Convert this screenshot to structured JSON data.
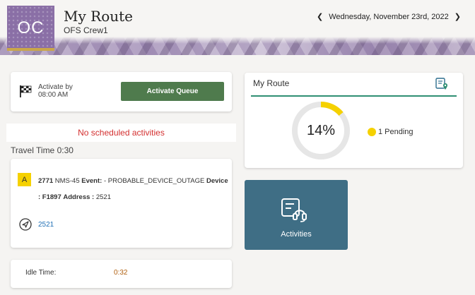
{
  "header": {
    "avatar_initials": "OC",
    "title": "My Route",
    "subtitle": "OFS Crew1",
    "date": "Wednesday, November 23rd, 2022",
    "prev_icon": "chevron-left-icon",
    "next_icon": "chevron-right-icon"
  },
  "activate": {
    "label_line1": "Activate by",
    "label_line2": "08:00 AM",
    "button_label": "Activate Queue",
    "icon": "checkered-flag-icon",
    "button_color": "#4f7b4d"
  },
  "no_scheduled": "No scheduled activities",
  "travel_time": "Travel Time 0:30",
  "activity": {
    "badge": "A",
    "id": "2771",
    "name": "NMS-45",
    "event_label": "Event:",
    "event_value": "- PROBABLE_DEVICE_OUTAGE",
    "device_label": "Device",
    "device_value": ": F1897",
    "address_label": "Address :",
    "address_value": "2521",
    "nav_icon": "navigation-arrow-icon",
    "nav_link": "2521",
    "badge_color": "#f5d100"
  },
  "idle": {
    "label": "Idle Time:",
    "value": "0:32"
  },
  "route": {
    "title": "My Route",
    "map_icon": "route-map-icon",
    "percent_label": "14%",
    "progress": 0.14,
    "pending_label": "1 Pending",
    "accent_color": "#2f8f73",
    "pending_color": "#f5d100"
  },
  "tile": {
    "label": "Activities",
    "icon": "activities-headset-icon",
    "color": "#3f6e85"
  }
}
